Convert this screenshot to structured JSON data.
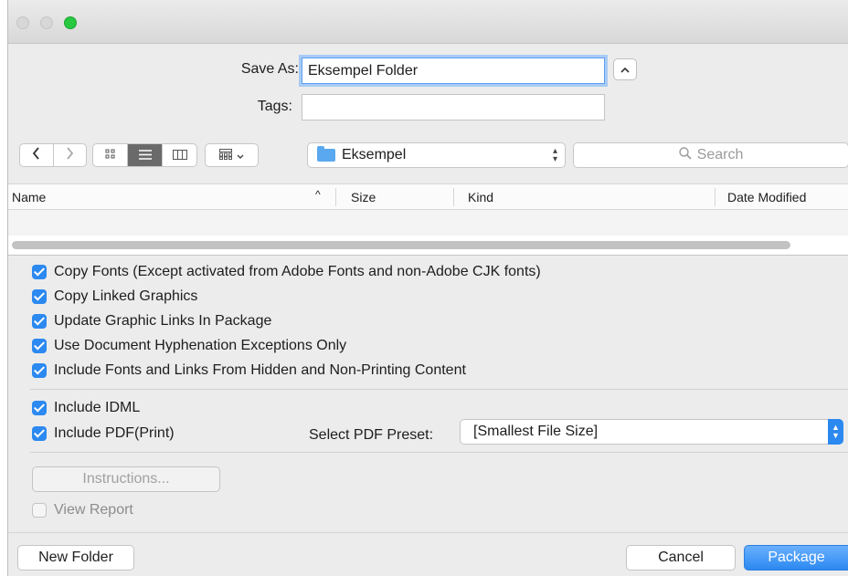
{
  "save_as": {
    "label": "Save As:",
    "value": "Eksempel Folder",
    "collapse_icon": "chevron-up-icon"
  },
  "tags": {
    "label": "Tags:",
    "value": ""
  },
  "toolbar": {
    "back_icon": "chevron-left-icon",
    "forward_icon": "chevron-right-icon",
    "view_modes": [
      "icon-view",
      "list-view",
      "column-view"
    ],
    "selected_view": "list-view",
    "group_icon": "gallery-group-icon",
    "location": "Eksempel",
    "search_placeholder": "Search"
  },
  "columns": {
    "name": "Name",
    "size": "Size",
    "kind": "Kind",
    "date_modified": "Date Modified"
  },
  "options": {
    "copy_fonts": "Copy Fonts (Except activated from Adobe Fonts and non-Adobe CJK fonts)",
    "copy_linked_graphics": "Copy Linked Graphics",
    "update_graphic_links": "Update Graphic Links In Package",
    "use_hyphenation": "Use Document Hyphenation Exceptions Only",
    "include_hidden": "Include Fonts and Links From Hidden and Non-Printing Content",
    "include_idml": "Include IDML",
    "include_pdf": "Include PDF(Print)",
    "pdf_preset_label": "Select PDF Preset:",
    "pdf_preset_value": "[Smallest File Size]",
    "instructions": "Instructions...",
    "view_report": "View Report"
  },
  "footer": {
    "new_folder": "New Folder",
    "cancel": "Cancel",
    "package": "Package"
  },
  "colors": {
    "accent": "#2b89f0",
    "focus_ring": "#a8cbf5",
    "close_green": "#28c840"
  }
}
